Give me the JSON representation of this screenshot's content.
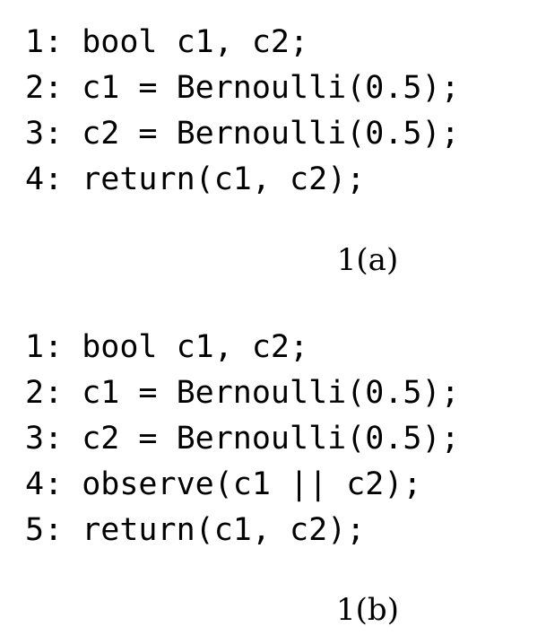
{
  "figure_a": {
    "lines": [
      "1: bool c1, c2;",
      "2: c1 = Bernoulli(0.5);",
      "3: c2 = Bernoulli(0.5);",
      "4: return(c1, c2);"
    ],
    "caption": "1(a)"
  },
  "figure_b": {
    "lines": [
      "1: bool c1, c2;",
      "2: c1 = Bernoulli(0.5);",
      "3: c2 = Bernoulli(0.5);",
      "4: observe(c1 || c2);",
      "5: return(c1, c2);"
    ],
    "caption": "1(b)"
  }
}
